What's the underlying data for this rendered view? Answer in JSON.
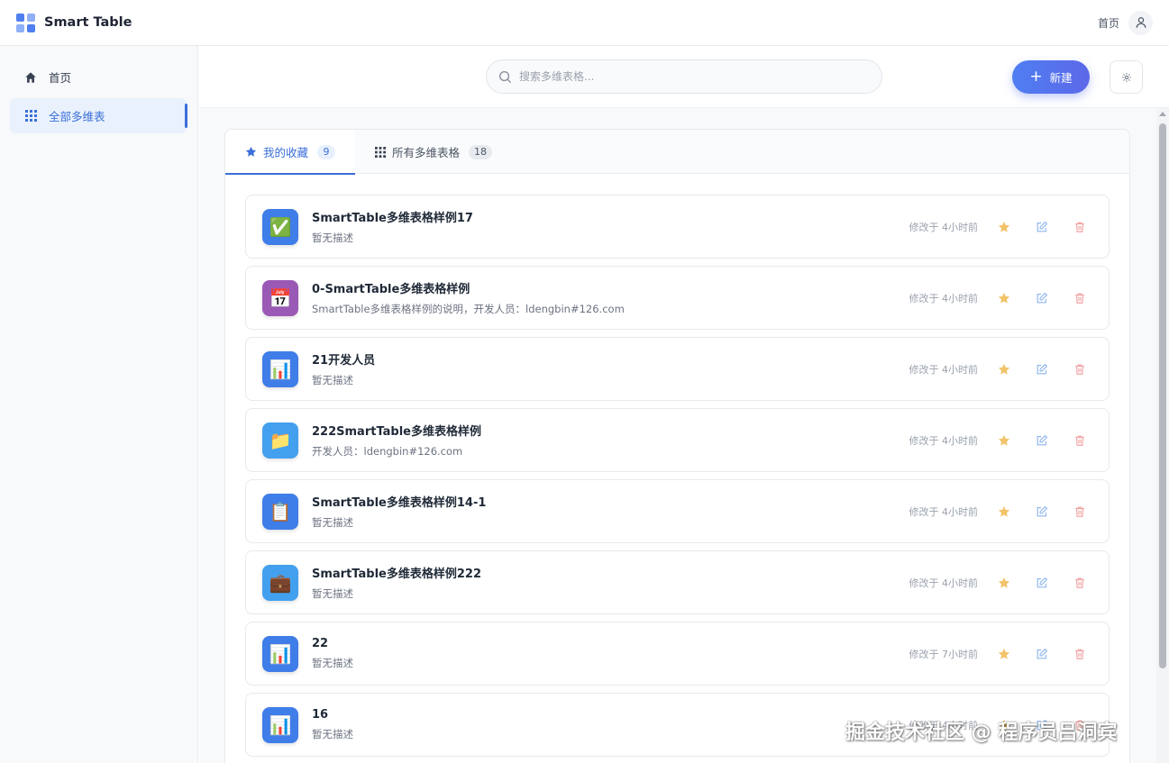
{
  "app": {
    "title": "Smart Table"
  },
  "topbar": {
    "home_label": "首页",
    "user_icon": "user-icon"
  },
  "sidebar": {
    "items": [
      {
        "label": "首页",
        "icon": "home-icon",
        "active": false
      },
      {
        "label": "全部多维表",
        "icon": "grid-icon",
        "active": true
      }
    ]
  },
  "header": {
    "search_placeholder": "搜索多维表格...",
    "new_label": "新建",
    "settings_icon": "gear-icon"
  },
  "tabs": [
    {
      "label": "我的收藏",
      "count": "9",
      "icon": "star-icon",
      "active": true
    },
    {
      "label": "所有多维表格",
      "count": "18",
      "icon": "grid-icon",
      "active": false
    }
  ],
  "tables": [
    {
      "title": "SmartTable多维表格样例17",
      "desc": "暂无描述",
      "modified": "修改于 4小时前",
      "icon": "checkmark-icon",
      "icon_glyph": "✅",
      "icon_bg": "#3f7de8"
    },
    {
      "title": "0-SmartTable多维表格样例",
      "desc": "SmartTable多维表格样例的说明，开发人员：ldengbin#126.com",
      "modified": "修改于 4小时前",
      "icon": "calendar-icon",
      "icon_glyph": "📅",
      "icon_bg": "#9b59b6"
    },
    {
      "title": "21开发人员",
      "desc": "暂无描述",
      "modified": "修改于 4小时前",
      "icon": "bar-chart-icon",
      "icon_glyph": "📊",
      "icon_bg": "#3f7de8"
    },
    {
      "title": "222SmartTable多维表格样例",
      "desc": "开发人员：ldengbin#126.com",
      "modified": "修改于 4小时前",
      "icon": "folder-icon",
      "icon_glyph": "📁",
      "icon_bg": "#43a0ef"
    },
    {
      "title": "SmartTable多维表格样例14-1",
      "desc": "暂无描述",
      "modified": "修改于 4小时前",
      "icon": "clipboard-icon",
      "icon_glyph": "📋",
      "icon_bg": "#3f7de8"
    },
    {
      "title": "SmartTable多维表格样例222",
      "desc": "暂无描述",
      "modified": "修改于 4小时前",
      "icon": "briefcase-icon",
      "icon_glyph": "💼",
      "icon_bg": "#43a0ef"
    },
    {
      "title": "22",
      "desc": "暂无描述",
      "modified": "修改于 7小时前",
      "icon": "bar-chart-icon",
      "icon_glyph": "📊",
      "icon_bg": "#3f7de8"
    },
    {
      "title": "16",
      "desc": "暂无描述",
      "modified": "修改于 4小时前",
      "icon": "bar-chart-icon",
      "icon_glyph": "📊",
      "icon_bg": "#3f7de8"
    }
  ],
  "colors": {
    "accent": "#3b6fd9",
    "star": "#f2c36b",
    "edit": "#8fb6ee",
    "delete": "#f3a3a3"
  },
  "watermark": "掘金技术社区 @ 程序员吕洞宾"
}
